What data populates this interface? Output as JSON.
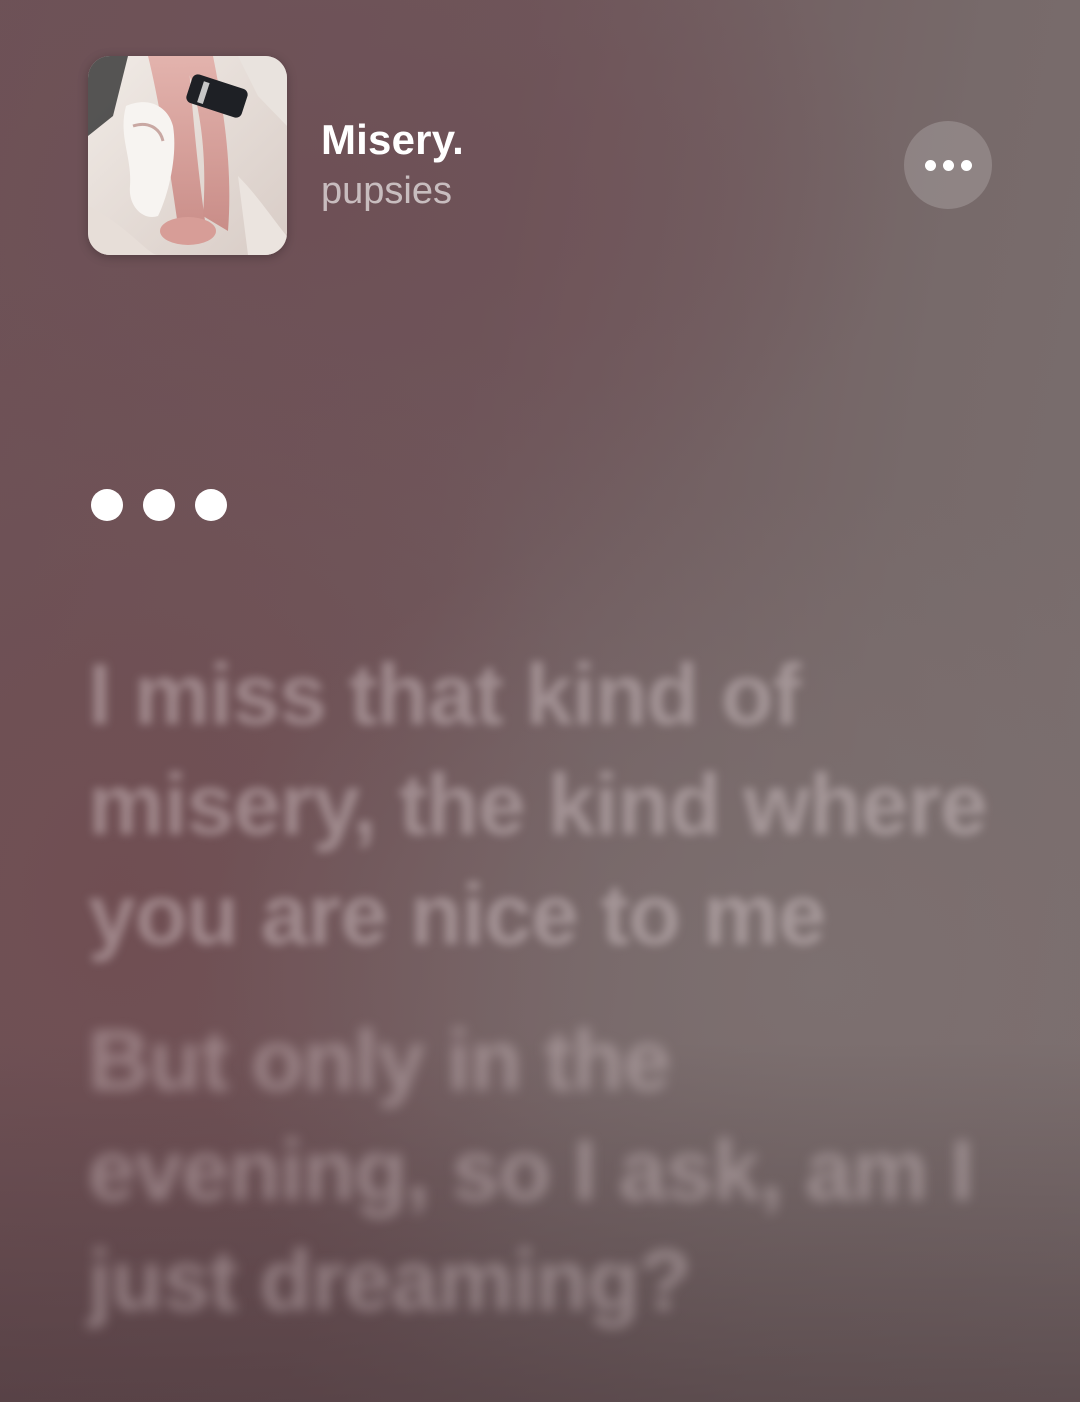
{
  "now_playing": {
    "title": "Misery.",
    "artist": "pupsies",
    "artwork": "album-artwork"
  },
  "more_button": {
    "icon": "ellipsis-icon"
  },
  "interlude": {
    "icon": "interlude-dots-icon",
    "dot_count": 3
  },
  "lyrics": {
    "lines": [
      "I miss that kind of misery, the kind where you are nice to me",
      "But only in the evening, so I ask, am I just dreaming?"
    ]
  },
  "colors": {
    "background": "#705a5e",
    "text_primary": "#ffffff",
    "text_secondary": "#c7b9bb"
  }
}
